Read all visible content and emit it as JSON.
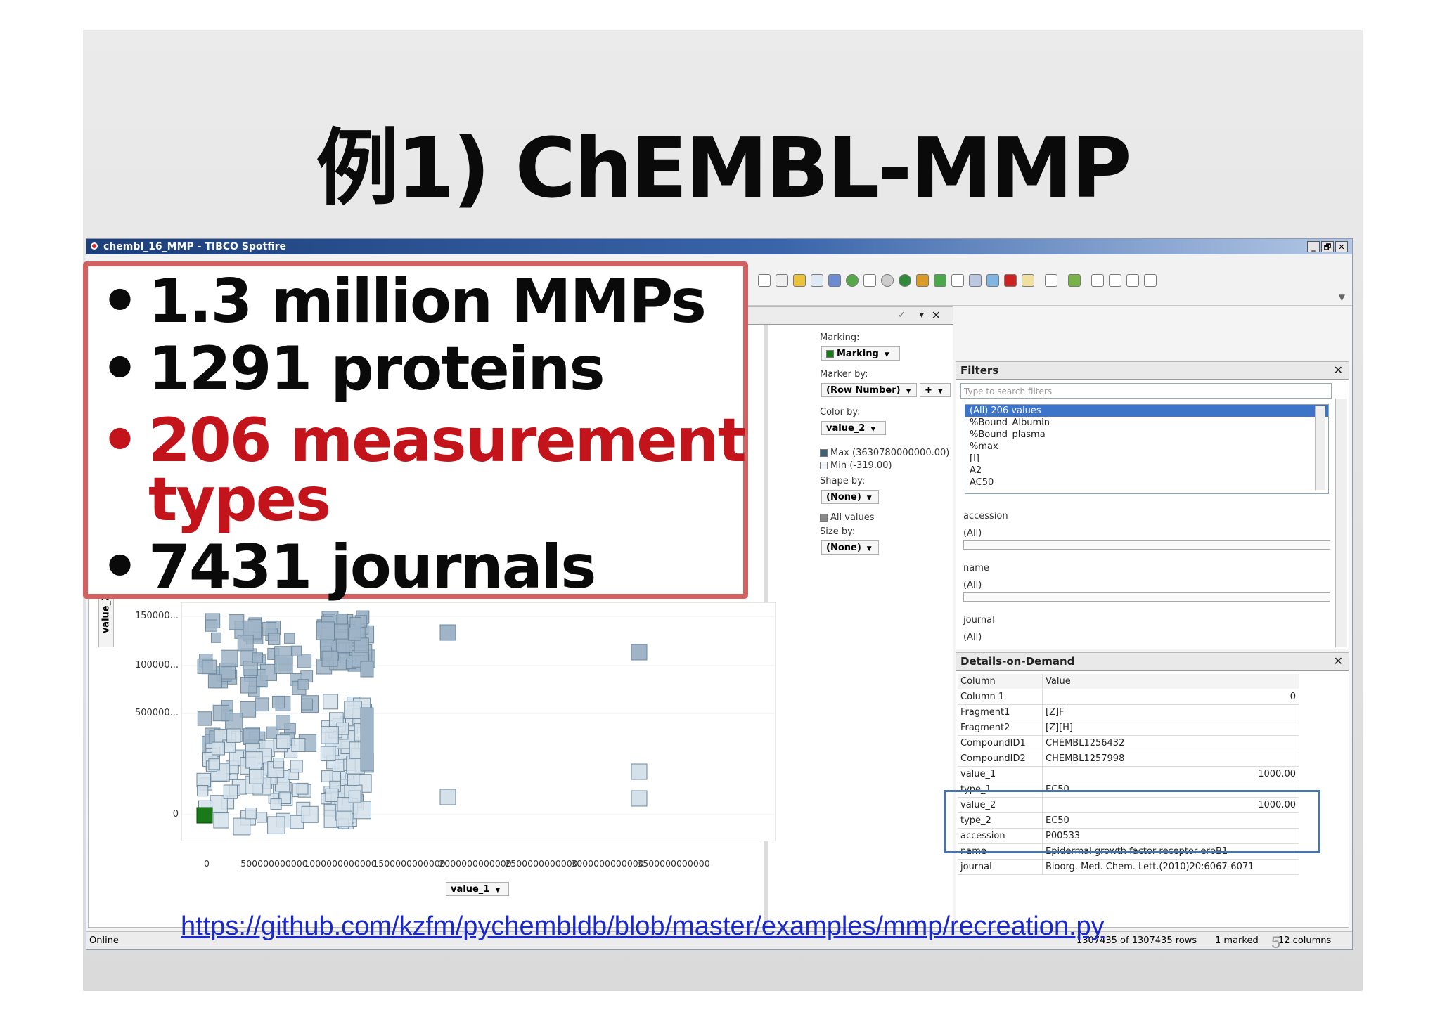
{
  "slide": {
    "title": "例1) ChEMBL-MMP",
    "url": "https://github.com/kzfm/pychembldb/blob/master/examples/mmp/recreation.py",
    "page_number": "5"
  },
  "callout": {
    "bullets": [
      {
        "text": "1.3 million MMPs",
        "color": "#0a0a0a"
      },
      {
        "text": "1291 proteins",
        "color": "#0a0a0a"
      },
      {
        "text": "206 measurement",
        "text2": "types",
        "color": "#c3141c"
      },
      {
        "text": "7431 journals",
        "color": "#0a0a0a"
      }
    ],
    "border_color": "#d26262"
  },
  "window": {
    "title": "chembl_16_MMP - TIBCO Spotfire",
    "controls": [
      "_",
      "🗗",
      "✕"
    ]
  },
  "properties": {
    "marking_label": "Marking:",
    "marking_value": "Marking",
    "marker_by_label": "Marker by:",
    "marker_by_value": "(Row Number)",
    "marker_by_extra": "+",
    "color_by_label": "Color by:",
    "color_by_value": "value_2",
    "legend_max": "Max (3630780000000.00)",
    "legend_min": "Min (-319.00)",
    "shape_by_label": "Shape by:",
    "shape_by_value": "(None)",
    "all_values": "All values",
    "size_by_label": "Size by:",
    "size_by_value": "(None)",
    "header_icons": [
      "✓",
      "▾",
      "✕"
    ]
  },
  "plot": {
    "y_axis_label": "value_2",
    "x_axis_selector": "value_1",
    "y_ticks": [
      "150000...",
      "100000...",
      "500000...",
      "0"
    ],
    "x_ticks": [
      "0",
      "500000000000",
      "1000000000000",
      "1500000000000",
      "2000000000000",
      "2500000000000",
      "3000000000000",
      "3500000000000"
    ],
    "marked_color": "#1a7a1a",
    "marker_color": "#9fb4c6"
  },
  "filters": {
    "title": "Filters",
    "search_placeholder": "Type to search filters",
    "list_items": [
      "(All) 206 values",
      "%Bound_Albumin",
      "%Bound_plasma",
      "%max",
      "[I]",
      "A2",
      "AC50"
    ],
    "groups": [
      {
        "name": "accession",
        "value": "(All)"
      },
      {
        "name": "name",
        "value": "(All)"
      },
      {
        "name": "journal",
        "value": "(All)"
      }
    ]
  },
  "dod": {
    "title": "Details-on-Demand",
    "headers": [
      "Column",
      "Value"
    ],
    "rows": [
      [
        "Column 1",
        "0"
      ],
      [
        "Fragment1",
        "[Z]F"
      ],
      [
        "Fragment2",
        "[Z][H]"
      ],
      [
        "CompoundID1",
        "CHEMBL1256432"
      ],
      [
        "CompoundID2",
        "CHEMBL1257998"
      ],
      [
        "value_1",
        "1000.00"
      ],
      [
        "type_1",
        "EC50"
      ],
      [
        "value_2",
        "1000.00"
      ],
      [
        "type_2",
        "EC50"
      ],
      [
        "accession",
        "P00533"
      ],
      [
        "name",
        "Epidermal growth factor receptor erbB1"
      ],
      [
        "journal",
        "Bioorg. Med. Chem. Lett.(2010)20:6067-6071"
      ]
    ],
    "highlight_color": "#4a73a8"
  },
  "status": {
    "left": "Online",
    "rows": "1307435 of 1307435 rows",
    "marked": "1 marked",
    "columns": "12 columns"
  }
}
